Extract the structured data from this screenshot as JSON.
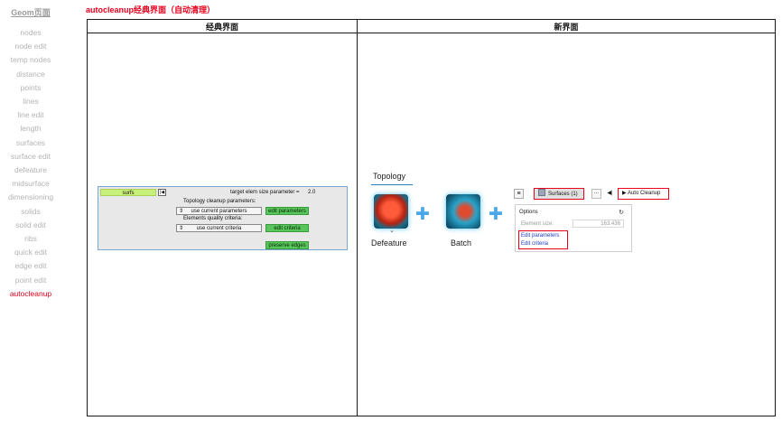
{
  "nav": {
    "title": "Geom页面",
    "items": [
      "nodes",
      "node edit",
      "temp nodes",
      "distance",
      "points",
      "lines",
      "line edit",
      "length",
      "surfaces",
      "surface edit",
      "defeature",
      "midsurface",
      "dimensioning",
      "solids",
      "solid edit",
      "ribs",
      "quick edit",
      "edge edit",
      "point edit",
      "autocleanup"
    ],
    "active": "autocleanup",
    "active_color": "#e8001c"
  },
  "page_title": "autocleanup经典界面（自动清理）",
  "table": {
    "classic_header": "经典界面",
    "new_header": "新界面"
  },
  "classic": {
    "surfs_label": "surfs",
    "reset_icon": "reset-icon",
    "target_label": "target elem size parameter =",
    "target_value": "2.0",
    "topology_label": "Topology cleanup parameters:",
    "use_current_params": "use current parameters",
    "edit_params": "edit parameters",
    "elem_quality_label": "Elements quality criteria:",
    "use_current_criteria": "use current criteria",
    "edit_criteria": "edit criteria",
    "preserve_edges": "preserve edges"
  },
  "new_ui": {
    "tab": "Topology",
    "tools": [
      {
        "label": "Defeature",
        "icon": "defeature-icon"
      },
      {
        "label": "Batch",
        "icon": "batch-icon"
      }
    ],
    "toolbar": {
      "menu_icon": "hamburger-icon",
      "surfaces": "Surfaces (1)",
      "dots": "···",
      "skip_icon": "skip-back-icon",
      "auto_cleanup": "Auto Cleanup"
    },
    "options": {
      "title": "Options",
      "element_size_label": "Element size:",
      "element_size_value": "163.436",
      "edit_parameters": "Edit parameters",
      "edit_criteria": "Edit criteria"
    }
  }
}
